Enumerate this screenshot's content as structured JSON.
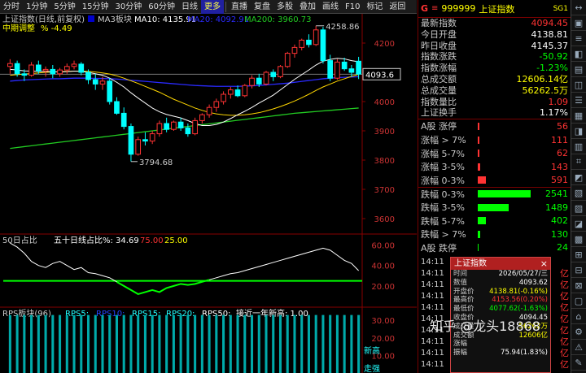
{
  "toolbar": {
    "items": [
      "分时",
      "1分钟",
      "5分钟",
      "15分钟",
      "30分钟",
      "60分钟",
      "日线",
      "更多",
      "直播",
      "复盘",
      "多股",
      "叠加",
      "画线",
      "F10",
      "标记",
      "返回"
    ]
  },
  "chart": {
    "title": "上证指数(日线,前复权)",
    "ma_block": "MA3板块",
    "ma10": "MA10: 4135.91",
    "ma20": "MA20: 4092.91",
    "ma200": "MA200: 3960.73",
    "sub_title": "中期调整",
    "sub_value": "% -4.49",
    "high_label": "4258.86",
    "low_label": "3794.68",
    "current_price": "4093.6",
    "y_ticks": [
      "4200",
      "4100",
      "4000",
      "3900",
      "3800",
      "3700",
      "3600"
    ],
    "panel2_name": "50日占比",
    "panel2_label": "五十日线占比%: 34.69",
    "panel2_v1": "75.00",
    "panel2_v2": "25.00",
    "panel2_ticks": [
      "60.00",
      "40.00",
      "20.00"
    ],
    "panel3_name": "RPS板块(96)",
    "panel3_rps5": "RPS5:",
    "panel3_rps10": "RPS10:",
    "panel3_rps15": "RPS15:",
    "panel3_rps20": "RPS20:",
    "panel3_rps50": "RPS50:",
    "panel3_note": "接近一年新高: 1.00",
    "panel3_ticks": [
      "30.00",
      "20.00",
      "10.00"
    ],
    "panel3_tag1": "新高",
    "panel3_tag2": "走强"
  },
  "right": {
    "g": "G",
    "eq": "≡",
    "code": "999999",
    "name": "上证指数",
    "sg": "SG1",
    "quote": [
      {
        "k": "最新指数",
        "v": "4094.45",
        "c": "up"
      },
      {
        "k": "今日开盘",
        "v": "4138.81",
        "c": "wh"
      },
      {
        "k": "昨日收盘",
        "v": "4145.37",
        "c": "wh"
      },
      {
        "k": "指数涨跌",
        "v": "-50.92",
        "c": "dn"
      },
      {
        "k": "指数涨幅",
        "v": "-1.23%",
        "c": "dn"
      },
      {
        "k": "总成交额",
        "v": "12606.14亿",
        "c": "yl"
      },
      {
        "k": "总成交量",
        "v": "56262.5万",
        "c": "yl"
      },
      {
        "k": "指数量比",
        "v": "1.09",
        "c": "up"
      },
      {
        "k": "上证换手",
        "v": "1.17%",
        "c": "wh"
      }
    ],
    "updown": [
      {
        "k": "A股 涨停",
        "v": "56",
        "c": "up",
        "bar": 2
      },
      {
        "k": "涨幅 > 7%",
        "v": "111",
        "c": "up",
        "bar": 2
      },
      {
        "k": "涨幅 5-7%",
        "v": "62",
        "c": "up",
        "bar": 2
      },
      {
        "k": "涨幅 3-5%",
        "v": "143",
        "c": "up",
        "bar": 3
      },
      {
        "k": "涨幅 0-3%",
        "v": "591",
        "c": "up",
        "bar": 10
      },
      {
        "k": "跌幅 0-3%",
        "v": "2541",
        "c": "dn",
        "bar": 65
      },
      {
        "k": "跌幅 3-5%",
        "v": "1489",
        "c": "dn",
        "bar": 38
      },
      {
        "k": "跌幅 5-7%",
        "v": "402",
        "c": "dn",
        "bar": 10
      },
      {
        "k": "跌幅 > 7%",
        "v": "130",
        "c": "dn",
        "bar": 3
      },
      {
        "k": "A股 跌停",
        "v": "24",
        "c": "dn",
        "bar": 1
      }
    ],
    "ticks": [
      {
        "t": "14:11",
        "r": ""
      },
      {
        "t": "14:11",
        "r": "亿"
      },
      {
        "t": "14:11",
        "r": "亿"
      },
      {
        "t": "14:11",
        "r": "亿"
      },
      {
        "t": "14:11",
        "r": "亿"
      },
      {
        "t": "14:11",
        "r": "亿"
      },
      {
        "t": "14:11",
        "r": "亿"
      },
      {
        "t": "14:11",
        "r": "亿"
      },
      {
        "t": "14:11",
        "r": "亿"
      },
      {
        "t": "14:11",
        "r": "亿"
      }
    ]
  },
  "popup": {
    "title": "上证指数",
    "close": "×",
    "rows": [
      {
        "k": "时间",
        "v": "2026/05/27/三",
        "c": "wh"
      },
      {
        "k": "数值",
        "v": "4093.62",
        "c": "wh"
      },
      {
        "k": "开盘价",
        "v": "4138.81(-0.16%)",
        "c": "yl"
      },
      {
        "k": "最高价",
        "v": "4153.56(0.20%)",
        "c": "up"
      },
      {
        "k": "最低价",
        "v": "4077.62(-1.63%)",
        "c": "dn"
      },
      {
        "k": "收盘价",
        "v": "4094.45",
        "c": "wh"
      },
      {
        "k": "成交量",
        "v": "56262万",
        "c": "yl"
      },
      {
        "k": "成交额",
        "v": "12606亿",
        "c": "yl"
      },
      {
        "k": "涨幅",
        "v": "",
        "c": "wh"
      },
      {
        "k": "振幅",
        "v": "75.94(1.83%)",
        "c": "wh"
      }
    ]
  },
  "watermark": "知乎 @龙头18868",
  "colors": {
    "up": "#ff3333",
    "down": "#00ff00",
    "ma10": "#ffffff",
    "ma20": "#ffd700",
    "ma60": "#2a2aff",
    "ma200": "#22cc22",
    "bg": "#000000"
  },
  "chart_data": {
    "type": "candlestick",
    "y_range": [
      3550,
      4300
    ],
    "candles": [
      [
        4120,
        4145,
        4095,
        4130
      ],
      [
        4130,
        4140,
        4085,
        4095
      ],
      [
        4095,
        4110,
        4070,
        4090
      ],
      [
        4090,
        4135,
        4085,
        4125
      ],
      [
        4125,
        4140,
        4095,
        4105
      ],
      [
        4105,
        4120,
        4085,
        4110
      ],
      [
        4110,
        4125,
        4080,
        4095
      ],
      [
        4095,
        4115,
        4085,
        4108
      ],
      [
        4108,
        4130,
        4095,
        4120
      ],
      [
        4120,
        4140,
        4110,
        4128
      ],
      [
        4128,
        4135,
        4090,
        4100
      ],
      [
        4100,
        4110,
        4060,
        4075
      ],
      [
        4075,
        4095,
        4040,
        4060
      ],
      [
        4060,
        4085,
        4040,
        4070
      ],
      [
        4070,
        4080,
        3990,
        4000
      ],
      [
        4000,
        4015,
        3955,
        3960
      ],
      [
        3960,
        3980,
        3905,
        3915
      ],
      [
        3915,
        3925,
        3795,
        3820
      ],
      [
        3820,
        3880,
        3815,
        3870
      ],
      [
        3870,
        3895,
        3850,
        3865
      ],
      [
        3865,
        3900,
        3855,
        3890
      ],
      [
        3890,
        3935,
        3880,
        3925
      ],
      [
        3925,
        3945,
        3895,
        3905
      ],
      [
        3905,
        3935,
        3900,
        3930
      ],
      [
        3930,
        3945,
        3900,
        3910
      ],
      [
        3910,
        3925,
        3880,
        3890
      ],
      [
        3890,
        3945,
        3885,
        3935
      ],
      [
        3935,
        3960,
        3925,
        3955
      ],
      [
        3955,
        3990,
        3945,
        3980
      ],
      [
        3980,
        4010,
        3965,
        4000
      ],
      [
        4000,
        4035,
        3990,
        4025
      ],
      [
        4025,
        4050,
        4010,
        4040
      ],
      [
        4040,
        4055,
        4015,
        4020
      ],
      [
        4020,
        4060,
        4015,
        4055
      ],
      [
        4055,
        4090,
        4045,
        4080
      ],
      [
        4080,
        4095,
        4050,
        4060
      ],
      [
        4060,
        4105,
        4055,
        4100
      ],
      [
        4100,
        4110,
        4070,
        4085
      ],
      [
        4085,
        4125,
        4080,
        4120
      ],
      [
        4120,
        4170,
        4115,
        4165
      ],
      [
        4165,
        4195,
        4150,
        4185
      ],
      [
        4185,
        4215,
        4175,
        4210
      ],
      [
        4210,
        4230,
        4185,
        4195
      ],
      [
        4195,
        4259,
        4190,
        4245
      ],
      [
        4245,
        4255,
        4130,
        4140
      ],
      [
        4140,
        4160,
        4070,
        4080
      ],
      [
        4080,
        4145,
        4075,
        4135
      ],
      [
        4135,
        4150,
        4105,
        4112
      ],
      [
        4112,
        4125,
        4085,
        4100
      ],
      [
        4138,
        4153,
        4077,
        4094
      ]
    ],
    "ma10": [
      4110,
      4108,
      4105,
      4104,
      4103,
      4103,
      4102,
      4101,
      4102,
      4104,
      4103,
      4100,
      4095,
      4090,
      4080,
      4066,
      4050,
      4030,
      4012,
      3995,
      3978,
      3965,
      3956,
      3950,
      3944,
      3935,
      3925,
      3918,
      3918,
      3922,
      3930,
      3942,
      3955,
      3967,
      3980,
      3995,
      4008,
      4022,
      4040,
      4058,
      4076,
      4092,
      4108,
      4125,
      4138,
      4144,
      4148,
      4146,
      4140,
      4136
    ],
    "ma20": [
      4090,
      4092,
      4094,
      4096,
      4098,
      4100,
      4101,
      4102,
      4103,
      4104,
      4104,
      4103,
      4101,
      4098,
      4094,
      4088,
      4080,
      4071,
      4062,
      4052,
      4042,
      4032,
      4020,
      4008,
      3998,
      3988,
      3978,
      3970,
      3963,
      3958,
      3955,
      3953,
      3953,
      3955,
      3958,
      3962,
      3968,
      3975,
      3983,
      3992,
      4002,
      4013,
      4025,
      4038,
      4050,
      4060,
      4070,
      4078,
      4086,
      4093
    ],
    "ma60": [
      4070,
      4072,
      4074,
      4075,
      4076,
      4077,
      4078,
      4078,
      4079,
      4080,
      4080,
      4080,
      4079,
      4079,
      4078,
      4077,
      4075,
      4073,
      4071,
      4069,
      4067,
      4065,
      4063,
      4061,
      4059,
      4057,
      4055,
      4054,
      4053,
      4052,
      4052,
      4052,
      4052,
      4053,
      4054,
      4055,
      4057,
      4059,
      4061,
      4063,
      4066,
      4069,
      4072,
      4075,
      4078,
      4080,
      4082,
      4083,
      4084,
      4085
    ],
    "ma200": [
      3840,
      3843,
      3846,
      3849,
      3852,
      3855,
      3858,
      3861,
      3864,
      3867,
      3870,
      3873,
      3876,
      3879,
      3882,
      3885,
      3888,
      3891,
      3894,
      3897,
      3900,
      3903,
      3906,
      3909,
      3912,
      3915,
      3918,
      3921,
      3924,
      3927,
      3930,
      3933,
      3936,
      3939,
      3942,
      3945,
      3948,
      3951,
      3954,
      3957,
      3960,
      3962,
      3964,
      3966,
      3968,
      3970,
      3972,
      3974,
      3976,
      3978
    ],
    "panel2": [
      62,
      58,
      52,
      44,
      40,
      38,
      42,
      44,
      40,
      36,
      38,
      33,
      32,
      30,
      28,
      24,
      20,
      16,
      12,
      14,
      16,
      14,
      18,
      20,
      22,
      21,
      22,
      24,
      26,
      28,
      30,
      32,
      33,
      35,
      37,
      39,
      41,
      43,
      45,
      47,
      49,
      51,
      53,
      55,
      57,
      55,
      50,
      45,
      42,
      35
    ],
    "panel2_lines": [
      25
    ]
  }
}
